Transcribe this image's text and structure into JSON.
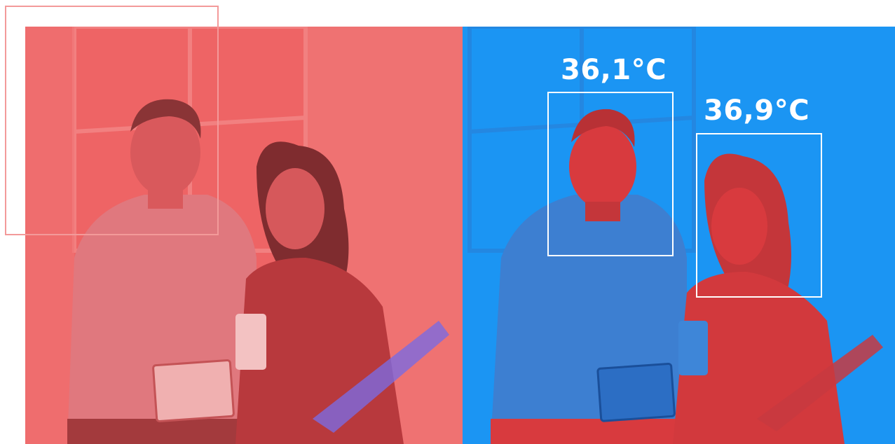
{
  "colors": {
    "left_panel": "#ee6465",
    "right_panel": "#1b95f3",
    "thermal_hot": "#d83a3e",
    "decor_frame": "#f39a9a",
    "overlay_text": "#ffffff"
  },
  "thermal_readings": [
    {
      "label": "36,1°C"
    },
    {
      "label": "36,9°C"
    }
  ]
}
